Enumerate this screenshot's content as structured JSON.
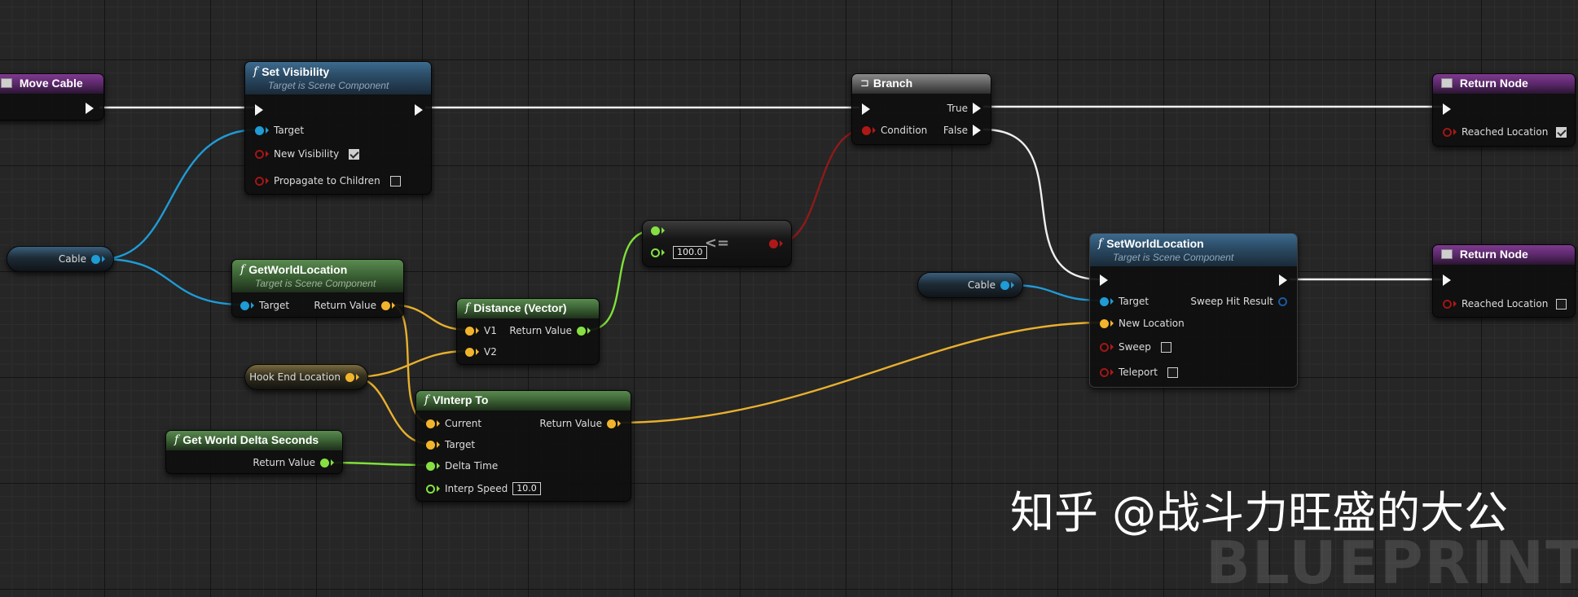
{
  "nodes": {
    "move_cable": {
      "title": "Move Cable"
    },
    "set_visibility": {
      "title": "Set Visibility",
      "subtitle": "Target is Scene Component",
      "pins": {
        "target": "Target",
        "new_visibility": "New Visibility",
        "propagate": "Propagate to Children"
      },
      "new_visibility_checked": true,
      "propagate_checked": false
    },
    "branch": {
      "title": "Branch",
      "pins": {
        "condition": "Condition",
        "true": "True",
        "false": "False"
      }
    },
    "return_node_1": {
      "title": "Return Node",
      "pin": "Reached Location",
      "checked": true
    },
    "return_node_2": {
      "title": "Return Node",
      "pin": "Reached Location",
      "checked": false
    },
    "cable_var_1": {
      "label": "Cable"
    },
    "cable_var_2": {
      "label": "Cable"
    },
    "get_world_location": {
      "title": "GetWorldLocation",
      "subtitle": "Target is Scene Component",
      "pins": {
        "target": "Target",
        "return_value": "Return Value"
      }
    },
    "less_equal": {
      "operator": "<=",
      "value": "100.0"
    },
    "distance": {
      "title": "Distance (Vector)",
      "pins": {
        "v1": "V1",
        "v2": "V2",
        "return_value": "Return Value"
      }
    },
    "hook_end_location": {
      "label": "Hook End Location"
    },
    "vinterp_to": {
      "title": "VInterp To",
      "pins": {
        "current": "Current",
        "target": "Target",
        "delta_time": "Delta Time",
        "interp_speed": "Interp Speed",
        "return_value": "Return Value"
      },
      "interp_speed_value": "10.0"
    },
    "get_world_delta_seconds": {
      "title": "Get World Delta Seconds",
      "pins": {
        "return_value": "Return Value"
      }
    },
    "set_world_location": {
      "title": "SetWorldLocation",
      "subtitle": "Target is Scene Component",
      "pins": {
        "target": "Target",
        "new_location": "New Location",
        "sweep": "Sweep",
        "teleport": "Teleport",
        "sweep_hit_result": "Sweep Hit Result"
      },
      "sweep_checked": false,
      "teleport_checked": false
    }
  },
  "watermark": "知乎 @战斗力旺盛的大公",
  "canvas_watermark": "BLUEPRINT",
  "colors": {
    "exec": "#f0f0f0",
    "object": "#1f9bd6",
    "vector": "#e8b02e",
    "float": "#7fe03a",
    "bool": "#8e1a1a",
    "function_header": "#2c4d68",
    "pure_header": "#3d6536",
    "event_header": "#5b286a"
  }
}
